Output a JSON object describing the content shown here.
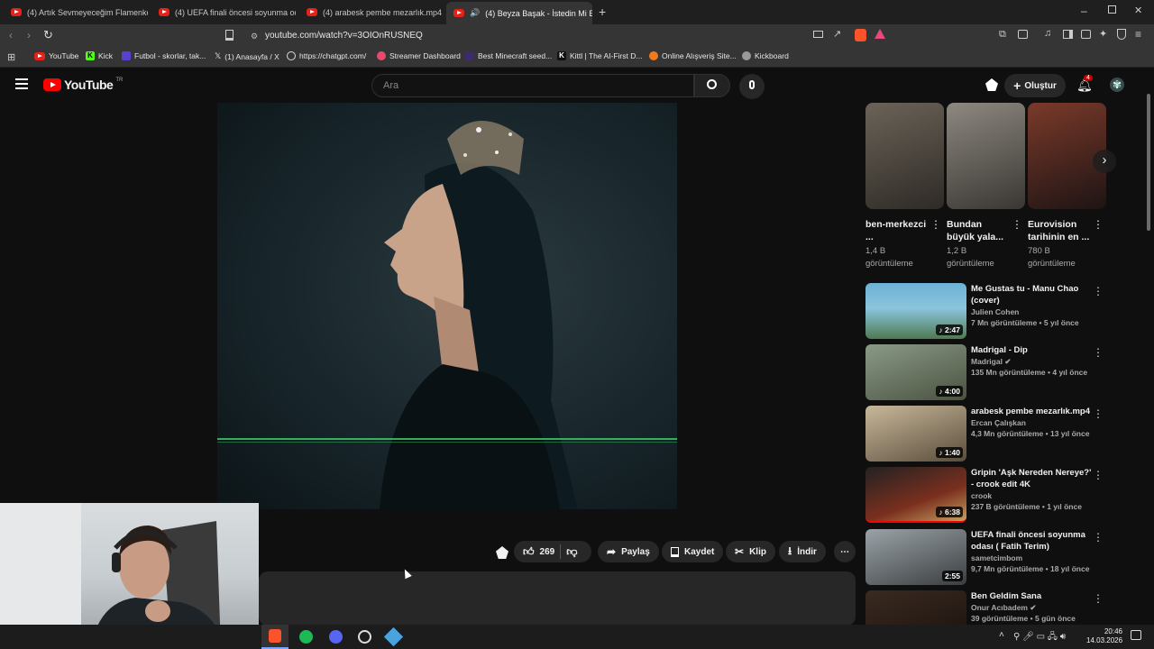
{
  "tabs": [
    {
      "label": "(4) Artık Sevmeyeceğim Flamenko Sa"
    },
    {
      "label": "(4) UEFA finali öncesi soyunma odası"
    },
    {
      "label": "(4) arabesk pembe mezarlık.mp4 - Yo"
    },
    {
      "label": "(4) Beyza Başak - İstedin Mi B"
    }
  ],
  "address": {
    "url": "youtube.com/watch?v=3OIOnRUSNEQ"
  },
  "bookmarks": [
    {
      "label": "YouTube"
    },
    {
      "label": "Kick"
    },
    {
      "label": "Futbol - skorlar, tak..."
    },
    {
      "label": "(1) Anasayfa / X"
    },
    {
      "label": "https://chatgpt.com/"
    },
    {
      "label": "Streamer Dashboard"
    },
    {
      "label": "Best Minecraft seed..."
    },
    {
      "label": "Kittl | The AI-First D..."
    },
    {
      "label": "Online Alışveriş Site..."
    },
    {
      "label": "Kickboard"
    }
  ],
  "youtube": {
    "logo_text": "YouTube",
    "region": "TR",
    "search_placeholder": "Ara",
    "create_label": "Oluştur",
    "notification_count": "4"
  },
  "actions": {
    "likes": "269",
    "share": "Paylaş",
    "save": "Kaydet",
    "clip": "Klip",
    "download": "İndir"
  },
  "shorts": [
    {
      "title": "ben-merkezci ...",
      "views": "1,4 B görüntüleme"
    },
    {
      "title": "Bundan büyük yala...",
      "views": "1,2 B görüntüleme"
    },
    {
      "title": "Eurovision tarihinin en ...",
      "views": "780 B görüntüleme"
    }
  ],
  "recommendations": [
    {
      "title": "Me Gustas tu - Manu Chao (cover)",
      "channel": "Julien Cohen",
      "meta": "7 Mn görüntüleme • 5 yıl önce",
      "duration": "2:47"
    },
    {
      "title": "Madrigal - Dip",
      "channel": "Madrigal",
      "meta": "135 Mn görüntüleme • 4 yıl önce",
      "duration": "4:00"
    },
    {
      "title": "arabesk pembe mezarlık.mp4",
      "channel": "Ercan Çalışkan",
      "meta": "4,3 Mn görüntüleme • 13 yıl önce",
      "duration": "1:40"
    },
    {
      "title": "Gripin 'Aşk Nereden Nereye?' - crook edit 4K",
      "channel": "crook",
      "meta": "237 B görüntüleme • 1 yıl önce",
      "duration": "6:38"
    },
    {
      "title": "UEFA finali öncesi soyunma odası ( Fatih Terim)",
      "channel": "sametcimbom",
      "meta": "9,7 Mn görüntüleme • 18 yıl önce",
      "duration": "2:55"
    },
    {
      "title": "Ben Geldim Sana",
      "channel": "Onur Acıbadem",
      "meta": "39 görüntüleme • 5 gün önce",
      "duration": ""
    }
  ],
  "taskbar": {
    "time": "20:46",
    "date": "14.03.2026"
  },
  "colors": {
    "bg": "#0f0f0f",
    "chip": "#272727",
    "accent": "#ff0000",
    "muted": "#aaaaaa"
  }
}
